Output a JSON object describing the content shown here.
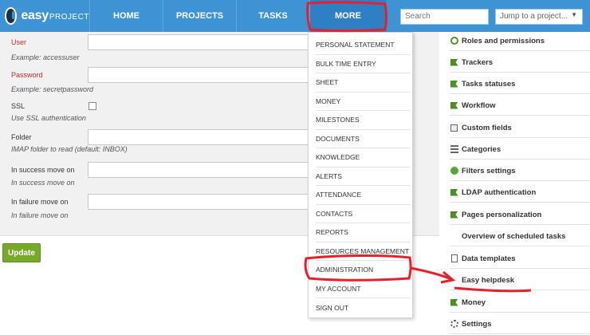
{
  "header": {
    "logo": {
      "main": "easy",
      "sub": "PROJECT"
    },
    "nav": [
      {
        "label": "HOME"
      },
      {
        "label": "PROJECTS"
      },
      {
        "label": "TASKS"
      },
      {
        "label": "MORE"
      }
    ],
    "search": {
      "placeholder": "Search",
      "value": ""
    },
    "jump": {
      "value": "Jump to a project..."
    }
  },
  "form": {
    "fields": [
      {
        "label": "User",
        "hint": "Example: accessuser",
        "required": true
      },
      {
        "label": "Password",
        "hint": "Example: secretpassword",
        "required": true
      },
      {
        "label": "SSL",
        "hint": "Use SSL authentication",
        "required": false
      },
      {
        "label": "Folder",
        "hint": "IMAP folder to read (default: INBOX)",
        "required": false
      },
      {
        "label": "In success move on",
        "hint": "In success move on",
        "required": false
      },
      {
        "label": "In failure move on",
        "hint": "In failure move on",
        "required": false
      }
    ],
    "update_label": "Update"
  },
  "more_menu": [
    "PERSONAL STATEMENT",
    "BULK TIME ENTRY",
    "SHEET",
    "MONEY",
    "MILESTONES",
    "DOCUMENTS",
    "KNOWLEDGE",
    "ALERTS",
    "ATTENDANCE",
    "CONTACTS",
    "REPORTS",
    "RESOURCES MANAGEMENT",
    "ADMINISTRATION",
    "MY ACCOUNT",
    "SIGN OUT"
  ],
  "admin_menu": [
    {
      "label": "Roles and permissions",
      "icon": "key-icon"
    },
    {
      "label": "Trackers",
      "icon": "tracker-icon"
    },
    {
      "label": "Tasks statuses",
      "icon": "status-icon"
    },
    {
      "label": "Workflow",
      "icon": "workflow-icon"
    },
    {
      "label": "Custom fields",
      "icon": "custom-fields-icon"
    },
    {
      "label": "Categories",
      "icon": "categories-icon"
    },
    {
      "label": "Filters settings",
      "icon": "filter-gear-icon"
    },
    {
      "label": "LDAP authentication",
      "icon": "ldap-icon"
    },
    {
      "label": "Pages personalization",
      "icon": "pages-icon"
    },
    {
      "label": "Overview of scheduled tasks",
      "icon": ""
    },
    {
      "label": "Data templates",
      "icon": "data-templates-icon"
    },
    {
      "label": "Easy helpdesk",
      "icon": ""
    },
    {
      "label": "Money",
      "icon": "money-icon"
    },
    {
      "label": "Settings",
      "icon": "settings-gear-icon"
    }
  ],
  "colors": {
    "topbar": "#3e93d5",
    "annotation": "#e8202c",
    "update_button": "#77aa2b"
  }
}
